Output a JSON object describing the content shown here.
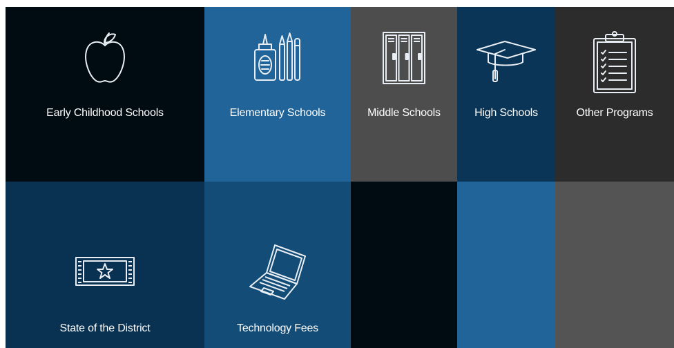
{
  "colors": {
    "black": "#010b12",
    "blue": "#20649a",
    "gray": "#4d4d4d",
    "navy": "#0b3556",
    "charcoal": "#2c2c2c",
    "navy_dark": "#083152",
    "blue_dark": "#134c76",
    "gray_light": "#545454",
    "icon_stroke": "#e8eef3"
  },
  "tiles": [
    {
      "label": "Early Childhood Schools",
      "icon": "apple-icon"
    },
    {
      "label": "Elementary Schools",
      "icon": "school-supplies-icon"
    },
    {
      "label": "Middle Schools",
      "icon": "lockers-icon"
    },
    {
      "label": "High Schools",
      "icon": "graduation-cap-icon"
    },
    {
      "label": "Other Programs",
      "icon": "clipboard-icon"
    },
    {
      "label": "State of the District",
      "icon": "ticket-star-icon"
    },
    {
      "label": "Technology Fees",
      "icon": "laptop-icon"
    },
    {
      "label": "",
      "icon": ""
    },
    {
      "label": "",
      "icon": ""
    },
    {
      "label": "",
      "icon": ""
    }
  ]
}
